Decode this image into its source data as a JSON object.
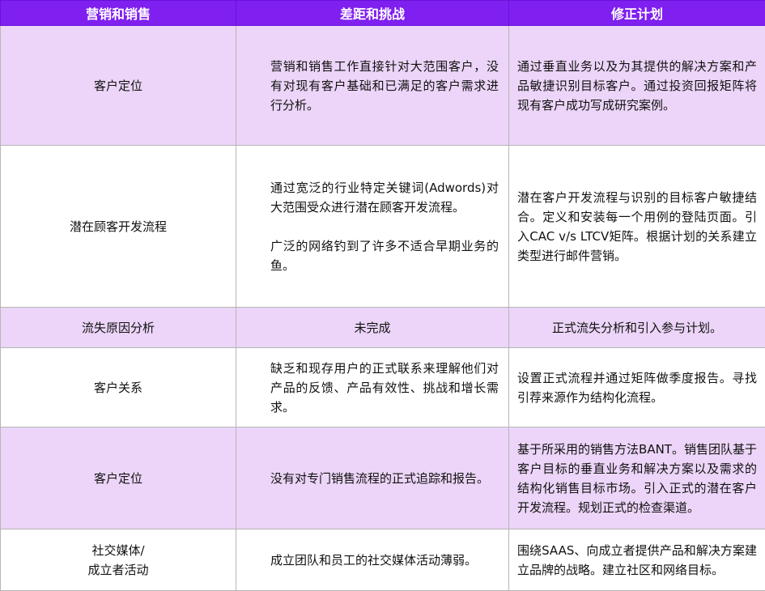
{
  "header": {
    "col1": "营销和销售",
    "col2": "差距和挑战",
    "col3": "修正计划"
  },
  "rows": [
    {
      "topic": "客户定位",
      "gap": [
        "营销和销售工作直接针对大范围客户，没有对现有客户基础和已满足的客户需求进行分析。"
      ],
      "plan": "通过垂直业务以及为其提供的解决方案和产品敏捷识别目标客户。通过投资回报矩阵将现有客户成功写成研究案例。"
    },
    {
      "topic": "潜在顾客开发流程",
      "gap": [
        "通过宽泛的行业特定关键词(Adwords)对大范围受众进行潜在顾客开发流程。",
        "广泛的网络钓到了许多不适合早期业务的鱼。"
      ],
      "plan": "潜在客户开发流程与识别的目标客户敏捷结合。定义和安装每一个用例的登陆页面。引入CAC v/s LTCV矩阵。根据计划的关系建立类型进行邮件营销。"
    },
    {
      "topic": "流失原因分析",
      "gap": [
        "未完成"
      ],
      "plan": "正式流失分析和引入参与计划。"
    },
    {
      "topic": "客户关系",
      "gap": [
        "缺乏和现存用户的正式联系来理解他们对产品的反馈、产品有效性、挑战和增长需求。"
      ],
      "plan": "设置正式流程并通过矩阵做季度报告。寻找引荐来源作为结构化流程。"
    },
    {
      "topic": "客户定位",
      "gap": [
        "没有对专门销售流程的正式追踪和报告。"
      ],
      "plan": "基于所采用的销售方法BANT。销售团队基于客户目标的垂直业务和解决方案以及需求的结构化销售目标市场。引入正式的潜在客户开发流程。规划正式的检查渠道。"
    },
    {
      "topic_line1": "社交媒体/",
      "topic_line2": "成立者活动",
      "gap": [
        "成立团队和员工的社交媒体活动薄弱。"
      ],
      "plan": "围绕SAAS、向成立者提供产品和解决方案建立品牌的战略。建立社区和网络目标。"
    }
  ],
  "colors": {
    "header_bg": "#7f1ff0",
    "row_purple": "#ecd5f8",
    "row_white": "#ffffff"
  }
}
